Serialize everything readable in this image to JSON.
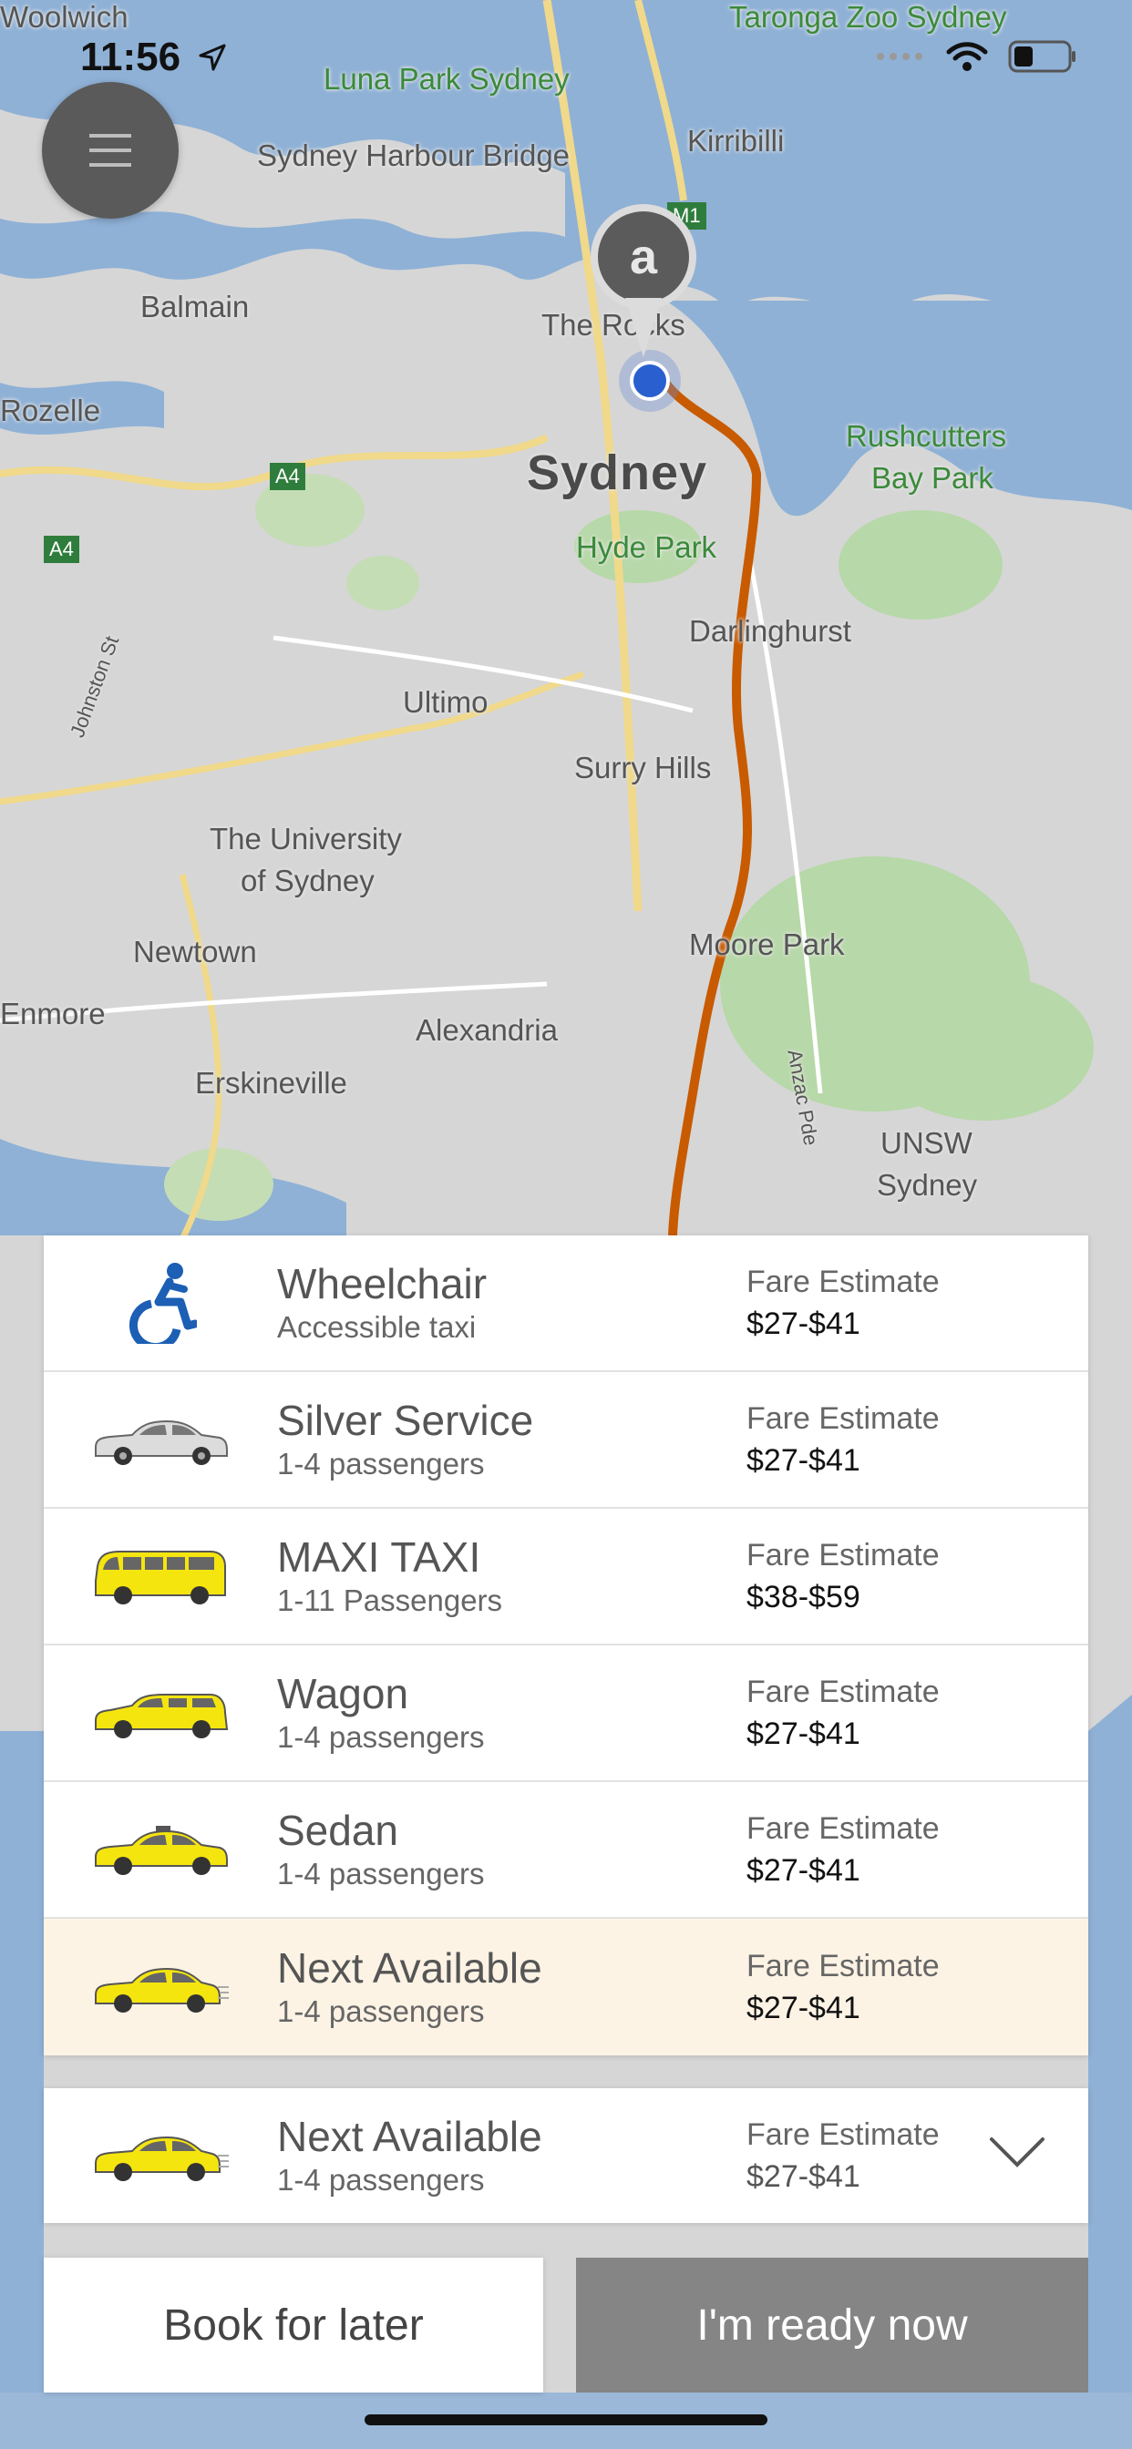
{
  "status_bar": {
    "time": "11:56"
  },
  "map": {
    "labels": {
      "woolwich": "Woolwich",
      "taronga": "Taronga Zoo Sydney",
      "luna_park": "Luna Park Sydney",
      "harbour_bridge": "Sydney Harbour Bridge",
      "kirribilli": "Kirribilli",
      "balmain": "Balmain",
      "the_rocks": "The Rocks",
      "rozelle": "Rozelle",
      "sydney": "Sydney",
      "rushcutters": "Rushcutters",
      "bay_park": "Bay Park",
      "hyde_park": "Hyde Park",
      "darlinghurst": "Darlinghurst",
      "ultimo": "Ultimo",
      "surry_hills": "Surry Hills",
      "university_1": "The University",
      "university_2": "of Sydney",
      "newtown": "Newtown",
      "moore_park": "Moore Park",
      "enmore": "Enmore",
      "alexandria": "Alexandria",
      "erskineville": "Erskineville",
      "unsw_1": "UNSW",
      "unsw_2": "Sydney",
      "johnston_st": "Johnston St",
      "anzac_pde": "Anzac Pde",
      "a4_1": "A4",
      "a4_2": "A4",
      "m1": "M1"
    },
    "pin_letter": "a"
  },
  "services": [
    {
      "name": "Wheelchair",
      "sub": "Accessible taxi",
      "fare_label": "Fare Estimate",
      "fare": "$27-$41",
      "icon": "wheelchair-icon"
    },
    {
      "name": "Silver Service",
      "sub": "1-4 passengers",
      "fare_label": "Fare Estimate",
      "fare": "$27-$41",
      "icon": "silver-car-icon"
    },
    {
      "name": "MAXI TAXI",
      "sub": "1-11 Passengers",
      "fare_label": "Fare Estimate",
      "fare": "$38-$59",
      "icon": "maxi-van-icon"
    },
    {
      "name": "Wagon",
      "sub": "1-4 passengers",
      "fare_label": "Fare Estimate",
      "fare": "$27-$41",
      "icon": "wagon-car-icon"
    },
    {
      "name": "Sedan",
      "sub": "1-4 passengers",
      "fare_label": "Fare Estimate",
      "fare": "$27-$41",
      "icon": "sedan-car-icon"
    },
    {
      "name": "Next Available",
      "sub": "1-4 passengers",
      "fare_label": "Fare Estimate",
      "fare": "$27-$41",
      "icon": "fast-car-icon"
    }
  ],
  "selected": {
    "name": "Next Available",
    "sub": "1-4 passengers",
    "fare_label": "Fare Estimate",
    "fare": "$27-$41"
  },
  "buttons": {
    "book_later": "Book for later",
    "ready_now": "I'm ready now"
  },
  "colors": {
    "route": "#c85a00",
    "selected_row": "#fdf3e5",
    "ready_button": "#858585",
    "taxi_yellow": "#f5e50f",
    "wheelchair_blue": "#1c5fb4"
  }
}
